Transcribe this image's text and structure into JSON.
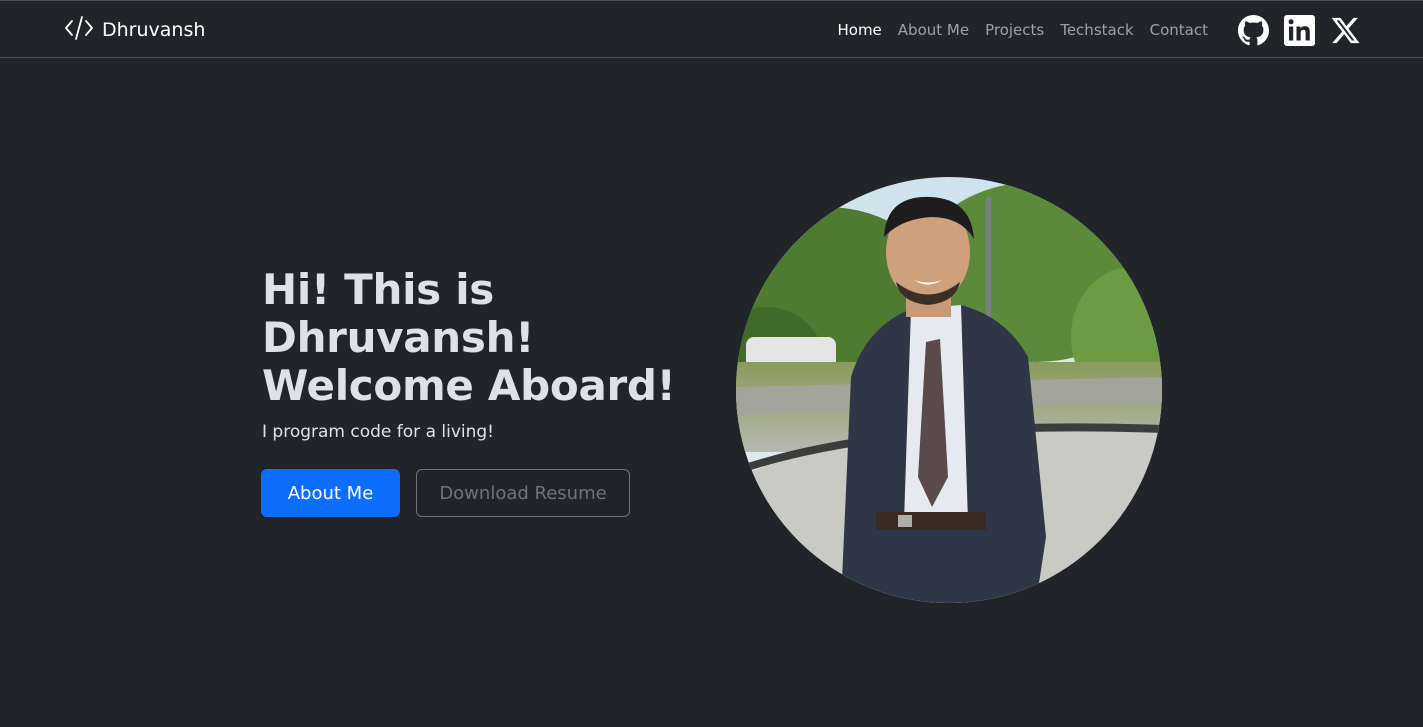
{
  "nav": {
    "brand": "Dhruvansh",
    "brand_icon": "code-icon",
    "links": [
      {
        "label": "Home",
        "active": true
      },
      {
        "label": "About Me",
        "active": false
      },
      {
        "label": "Projects",
        "active": false
      },
      {
        "label": "Techstack",
        "active": false
      },
      {
        "label": "Contact",
        "active": false
      }
    ],
    "socials": [
      "github-icon",
      "linkedin-icon",
      "x-icon"
    ]
  },
  "hero": {
    "title_lines": [
      "Hi! This is",
      "Dhruvansh!",
      "Welcome Aboard!"
    ],
    "subtitle": "I program code for a living!",
    "primary_button": "About Me",
    "secondary_button": "Download Resume",
    "photo": "profile-photo"
  },
  "colors": {
    "background": "#212529",
    "primary": "#0d6efd",
    "outline": "#6c757d",
    "text": "#dee2e6"
  }
}
